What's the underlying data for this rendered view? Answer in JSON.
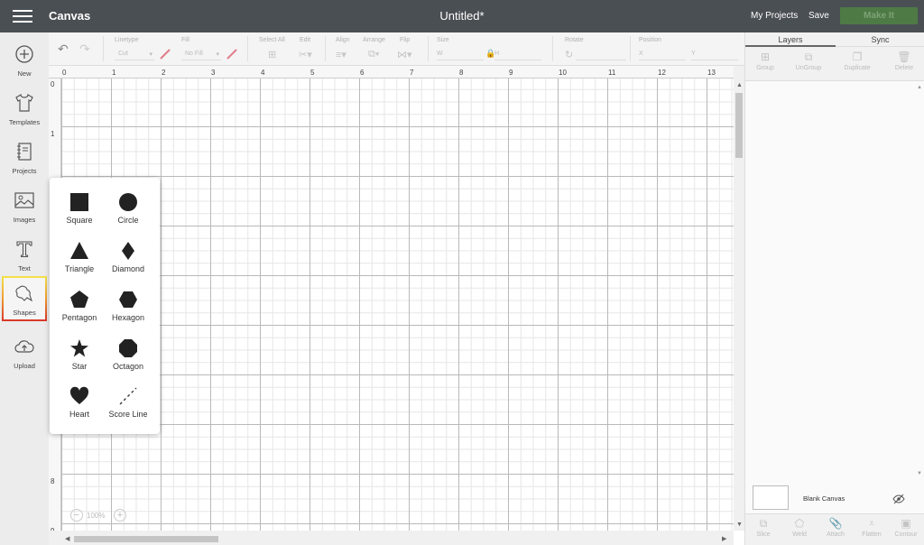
{
  "header": {
    "app_title": "Canvas",
    "doc_title": "Untitled*",
    "my_projects": "My Projects",
    "save": "Save",
    "make_it": "Make It",
    "accent_color": "#4e7a46"
  },
  "toolbar": {
    "linetype_label": "Linetype",
    "linetype_value": "Cut",
    "fill_label": "Fill",
    "fill_value": "No Fill",
    "select_all": "Select All",
    "edit": "Edit",
    "align": "Align",
    "arrange": "Arrange",
    "flip": "Flip",
    "size": "Size",
    "size_w": "W",
    "size_h": "H",
    "rotate": "Rotate",
    "position": "Position",
    "pos_x": "X",
    "pos_y": "Y"
  },
  "nav": [
    {
      "label": "New",
      "icon": "plus-circle-icon"
    },
    {
      "label": "Templates",
      "icon": "tshirt-icon"
    },
    {
      "label": "Projects",
      "icon": "notebook-icon"
    },
    {
      "label": "Images",
      "icon": "image-icon"
    },
    {
      "label": "Text",
      "icon": "text-t-icon"
    },
    {
      "label": "Shapes",
      "icon": "shapes-icon",
      "active": true
    },
    {
      "label": "Upload",
      "icon": "cloud-upload-icon"
    }
  ],
  "ruler": {
    "h": [
      "0",
      "1",
      "2",
      "3",
      "4",
      "5",
      "6",
      "7",
      "8",
      "9",
      "10",
      "11",
      "12",
      "13"
    ],
    "v": [
      "0",
      "1",
      "8",
      "9"
    ]
  },
  "zoom": {
    "value": "100%",
    "minus": "−",
    "plus": "+"
  },
  "shapes": [
    {
      "label": "Square",
      "icon": "square-icon"
    },
    {
      "label": "Circle",
      "icon": "circle-icon"
    },
    {
      "label": "Triangle",
      "icon": "triangle-icon"
    },
    {
      "label": "Diamond",
      "icon": "diamond-icon"
    },
    {
      "label": "Pentagon",
      "icon": "pentagon-icon"
    },
    {
      "label": "Hexagon",
      "icon": "hexagon-icon"
    },
    {
      "label": "Star",
      "icon": "star-icon"
    },
    {
      "label": "Octagon",
      "icon": "octagon-icon"
    },
    {
      "label": "Heart",
      "icon": "heart-icon"
    },
    {
      "label": "Score Line",
      "icon": "score-line-icon"
    }
  ],
  "right_panel": {
    "tabs": [
      "Layers",
      "Sync"
    ],
    "top_actions": [
      "Group",
      "UnGroup",
      "Duplicate",
      "Delete"
    ],
    "blank_canvas": "Blank Canvas",
    "bottom_actions": [
      "Slice",
      "Weld",
      "Attach",
      "Flatten",
      "Contour"
    ]
  }
}
